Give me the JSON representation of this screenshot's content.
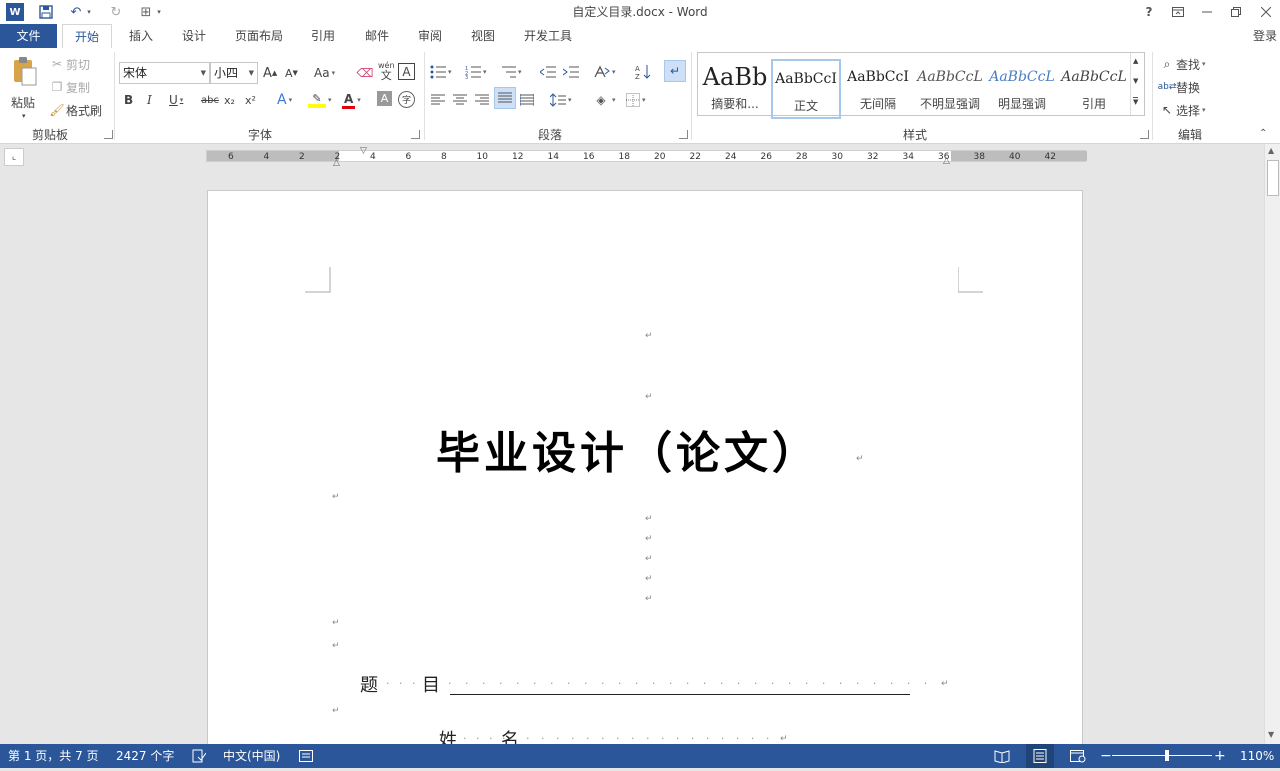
{
  "window": {
    "title": "自定义目录.docx - Word",
    "help": "?",
    "signin": "登录"
  },
  "tabs": {
    "file": "文件",
    "items": [
      "开始",
      "插入",
      "设计",
      "页面布局",
      "引用",
      "邮件",
      "审阅",
      "视图",
      "开发工具"
    ]
  },
  "clipboard": {
    "paste": "粘贴",
    "cut": "剪切",
    "copy": "复制",
    "format_painter": "格式刷",
    "label": "剪贴板"
  },
  "font": {
    "name": "宋体",
    "size": "小四",
    "label": "字体",
    "bold": "B",
    "italic": "I",
    "underline": "U",
    "strike": "abc",
    "sub": "x₂",
    "sup": "x²",
    "change_case": "Aa",
    "grow": "A",
    "shrink": "A",
    "phonetic_top": "wén",
    "phonetic_bottom": "文",
    "char_border": "A",
    "text_effect": "A",
    "font_color": "A",
    "char_shading": "A",
    "enclose": "字"
  },
  "paragraph": {
    "label": "段落"
  },
  "styles": {
    "label": "样式",
    "items": [
      {
        "preview": "AaBb",
        "name": "摘要和..."
      },
      {
        "preview": "AaBbCcI",
        "name": "正文"
      },
      {
        "preview": "AaBbCcI",
        "name": "无间隔"
      },
      {
        "preview": "AaBbCcL",
        "name": "不明显强调"
      },
      {
        "preview": "AaBbCcL",
        "name": "明显强调"
      },
      {
        "preview": "AaBbCcL",
        "name": "引用"
      }
    ]
  },
  "editing": {
    "find": "查找",
    "replace": "替换",
    "select": "选择",
    "label": "编辑"
  },
  "ruler": {
    "ticks": [
      "6",
      "4",
      "2",
      "2",
      "4",
      "6",
      "8",
      "10",
      "12",
      "14",
      "16",
      "18",
      "20",
      "22",
      "24",
      "26",
      "28",
      "30",
      "32",
      "34",
      "36",
      "38",
      "40",
      "42"
    ]
  },
  "document": {
    "title": "毕业设计（论文）",
    "para_mark": "↵",
    "topic_label_1": "题",
    "topic_label_2": "目",
    "name_label_1": "姓",
    "name_label_2": "名"
  },
  "status": {
    "page": "第 1 页，共 7 页",
    "words": "2427 个字",
    "lang": "中文(中国)",
    "zoom": "110%",
    "zoom_fraction": 0.55
  },
  "colors": {
    "accent": "#2b579a",
    "status_bg": "#2b579a",
    "highlight": "#ffff00",
    "font_color": "#e3000f"
  }
}
